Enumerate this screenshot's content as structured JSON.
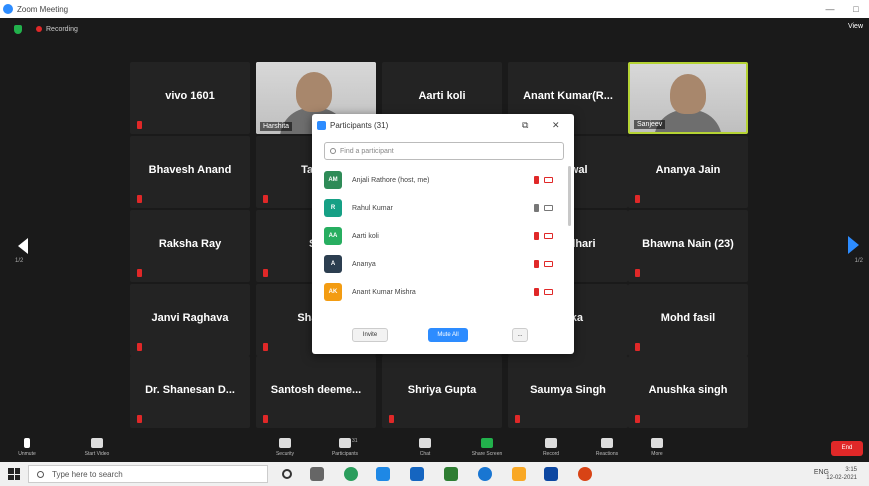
{
  "window": {
    "title": "Zoom Meeting",
    "minimize": "—",
    "maximize": "□",
    "view_label": "View"
  },
  "meeting": {
    "recording_label": "Recording"
  },
  "tiles": [
    {
      "name": "vivo 1601",
      "type": "name"
    },
    {
      "name": "",
      "type": "video",
      "caption": "Harshita"
    },
    {
      "name": "Aarti koli",
      "type": "name"
    },
    {
      "name": "Anant Kumar(R...",
      "type": "name"
    },
    {
      "name": "",
      "type": "video",
      "caption": "Sanjeev",
      "active": true
    },
    {
      "name": "Bhavesh Anand",
      "type": "name"
    },
    {
      "name": "Tarun",
      "type": "name"
    },
    {
      "name": "",
      "type": "name"
    },
    {
      "name": "Jaiswal",
      "type": "name"
    },
    {
      "name": "Ananya Jain",
      "type": "name"
    },
    {
      "name": "Raksha Ray",
      "type": "name"
    },
    {
      "name": "Sh",
      "type": "name"
    },
    {
      "name": "",
      "type": "name"
    },
    {
      "name": "Choudhari",
      "type": "name"
    },
    {
      "name": "Bhawna Nain (23)",
      "type": "name"
    },
    {
      "name": "Janvi Raghava",
      "type": "name"
    },
    {
      "name": "Shaury",
      "type": "name"
    },
    {
      "name": "",
      "type": "name"
    },
    {
      "name": "Anika",
      "type": "name"
    },
    {
      "name": "Mohd fasil",
      "type": "name"
    },
    {
      "name": "Dr. Shanesan D...",
      "type": "name"
    },
    {
      "name": "Santosh deeme...",
      "type": "name"
    },
    {
      "name": "Shriya Gupta",
      "type": "name"
    },
    {
      "name": "Saumya Singh",
      "type": "name"
    },
    {
      "name": "Anushka singh",
      "type": "name"
    }
  ],
  "pagination": {
    "left": "1/2",
    "right": "1/2"
  },
  "participants": {
    "title": "Participants (31)",
    "search_placeholder": "Find a participant",
    "list": [
      {
        "initials": "AM",
        "name": "Anjali Rathore (host, me)",
        "color": "#2e8b57",
        "mic": "muted",
        "cam": "off"
      },
      {
        "initials": "R",
        "name": "Rahul Kumar",
        "color": "#16a085",
        "mic": "on",
        "cam": "on"
      },
      {
        "initials": "AA",
        "name": "Aarti koli",
        "color": "#27ae60",
        "mic": "muted",
        "cam": "off"
      },
      {
        "initials": "A",
        "name": "Ananya",
        "color": "#2c3e50",
        "mic": "muted",
        "cam": "off"
      },
      {
        "initials": "AK",
        "name": "Anant Kumar Mishra",
        "color": "#f39c12",
        "mic": "muted",
        "cam": "off"
      }
    ],
    "invite_label": "Invite",
    "mute_all_label": "Mute All",
    "more_label": "..."
  },
  "toolbar": {
    "unmute": "Unmute",
    "start_video": "Start Video",
    "security": "Security",
    "participants": "Participants",
    "participants_count": "31",
    "chat": "Chat",
    "share_screen": "Share Screen",
    "record": "Record",
    "reactions": "Reactions",
    "more": "More",
    "end": "End"
  },
  "taskbar": {
    "search_placeholder": "Type here to search",
    "tray_text": "ENG",
    "time": "3:15",
    "date": "12-02-2021"
  }
}
